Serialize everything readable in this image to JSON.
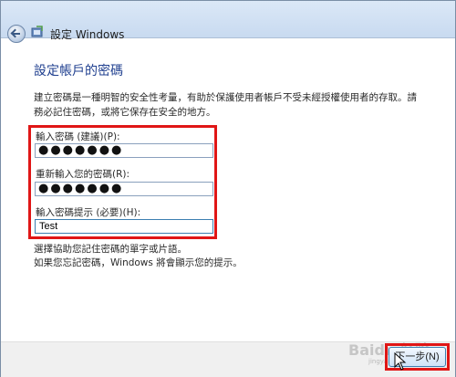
{
  "window": {
    "title": "設定 Windows"
  },
  "page": {
    "heading": "設定帳戶的密碼",
    "description": "建立密碼是一種明智的安全性考量，有助於保護使用者帳戶不受未經授權使用者的存取。請務必記住密碼，或將它保存在安全的地方。"
  },
  "form": {
    "password_label": "輸入密碼 (建議)(P):",
    "password_value": "●●●●●●●",
    "confirm_label": "重新輸入您的密碼(R):",
    "confirm_value": "●●●●●●●",
    "hint_label": "輸入密碼提示 (必要)(H):",
    "hint_value": "Test"
  },
  "hint_help": {
    "line1": "選擇協助您記住密碼的單字或片語。",
    "line2": "如果您忘記密碼，Windows 將會顯示您的提示。"
  },
  "footer": {
    "next_label": "下一步(N)"
  },
  "watermark": {
    "text": "Baidu 经验",
    "sub": "jingyan.baidu.com"
  },
  "colors": {
    "heading": "#1f3f8f",
    "highlight": "#e01616",
    "accent": "#3c7fb1"
  }
}
